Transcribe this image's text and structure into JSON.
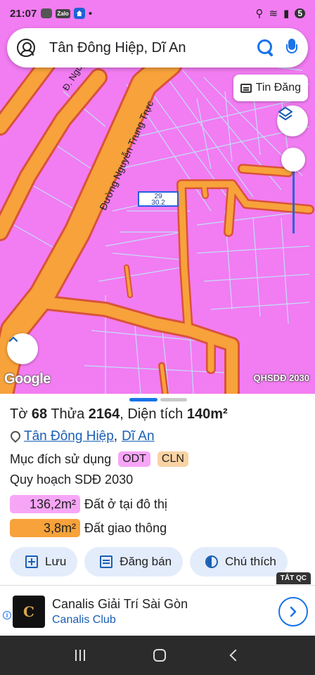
{
  "status_bar": {
    "time": "21:07",
    "app_label": "Zalo",
    "battery_badge": "5"
  },
  "search": {
    "query": "Tân Đông Hiệp, Dĩ An"
  },
  "map": {
    "tin_dang_label": "Tin Đăng",
    "road_labels": [
      "Đ. Nguyễn",
      "Đường Nguyễn Trung Trực"
    ],
    "parcel_number": "29",
    "parcel_area": "30.2",
    "google_label": "Google",
    "planning_label": "QHSDĐ 2030",
    "colors": {
      "residential": "#f27cf2",
      "road": "#f7a23a",
      "road_border": "#d9533a",
      "parcel_line": "#bfe4f7",
      "selected": "#2a62d8"
    }
  },
  "sheet": {
    "title_prefix": "Tờ ",
    "sheet_no": "68",
    "title_mid": " Thửa ",
    "parcel_no": "2164",
    "title_area_prefix": ", Diện tích ",
    "area": "140m²",
    "ward": "Tân Đông Hiệp",
    "separator": ",",
    "district": "Dĩ An",
    "purpose_label": "Mục đích sử dụng",
    "purpose_codes": [
      "ODT",
      "CLN"
    ],
    "plan_label": "Quy hoạch SDĐ 2030",
    "plan_areas": [
      {
        "value": "136,2m²",
        "label": "Đất ở tại đô thị"
      },
      {
        "value": "3,8m²",
        "label": "Đất giao thông"
      }
    ],
    "actions": [
      "Lưu",
      "Đăng bán",
      "Chú thích"
    ],
    "ad_close_label": "TẮT QC"
  },
  "ad": {
    "logo_text": "C",
    "title": "Canalis Giải Trí Sài Gòn",
    "subtitle": "Canalis Club",
    "info": "i"
  }
}
